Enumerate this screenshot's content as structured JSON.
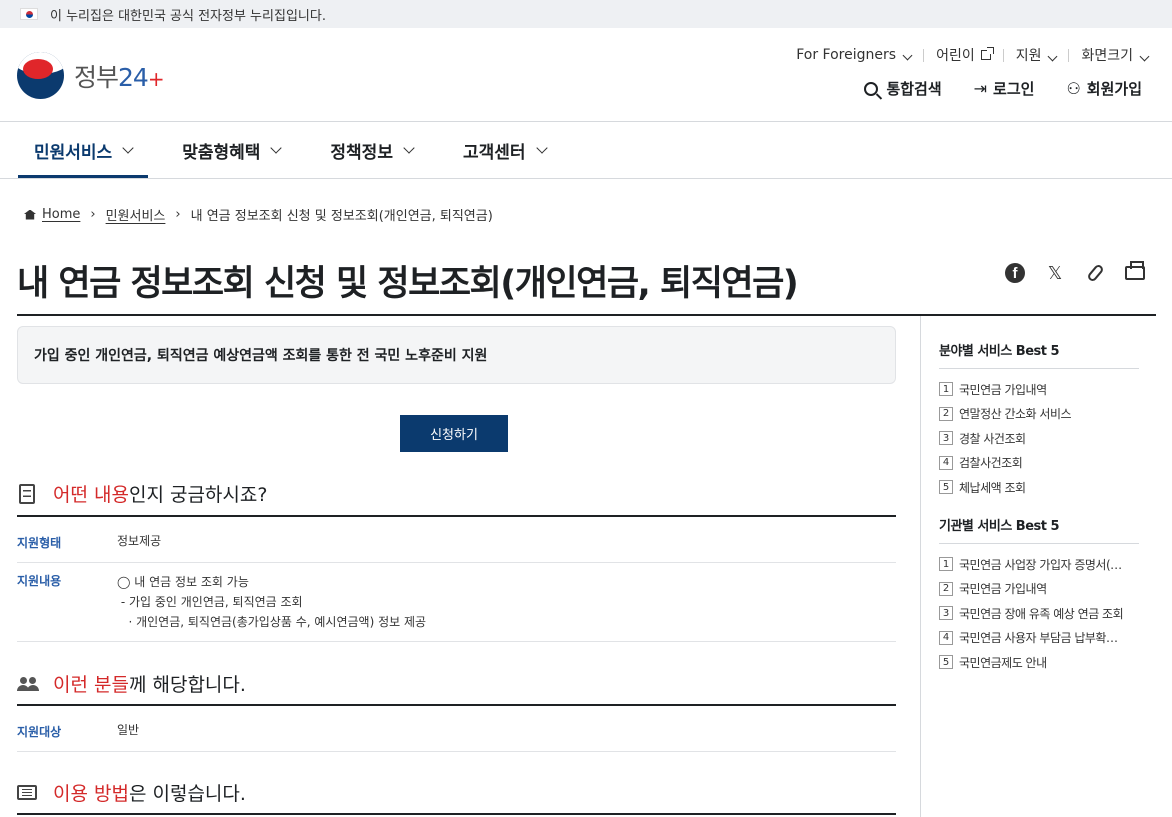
{
  "topbar": {
    "notice": "이 누리집은 대한민국 공식 전자정부 누리집입니다."
  },
  "logo": {
    "text_main": "정부",
    "text_num": "24",
    "plus": "+"
  },
  "util": {
    "foreigners": "For Foreigners",
    "kids": "어린이",
    "support": "지원",
    "zoom": "화면크기"
  },
  "actions": {
    "search": "통합검색",
    "login": "로그인",
    "signup": "회원가입"
  },
  "nav": [
    {
      "label": "민원서비스"
    },
    {
      "label": "맞춤형혜택"
    },
    {
      "label": "정책정보"
    },
    {
      "label": "고객센터"
    }
  ],
  "breadcrumb": {
    "home": "Home",
    "level1": "민원서비스",
    "current": "내 연금 정보조회 신청 및 정보조회(개인연금, 퇴직연금)"
  },
  "page": {
    "title": "내 연금 정보조회 신청 및 정보조회(개인연금, 퇴직연금)",
    "summary": "가입 중인 개인연금, 퇴직연금 예상연금액 조회를 통한 전 국민 노후준비 지원",
    "apply_button": "신청하기"
  },
  "sections": {
    "what": {
      "hl": "어떤 내용",
      "rest": "인지 궁금하시죠?"
    },
    "who": {
      "hl": "이런 분들",
      "rest": "께 해당합니다."
    },
    "how": {
      "hl": "이용 방법",
      "rest": "은 이렇습니다."
    }
  },
  "rows": {
    "type": {
      "key": "지원형태",
      "value": "정보제공"
    },
    "content": {
      "key": "지원내용",
      "line1": "◯ 내 연금 정보 조회 가능",
      "line2": " - 가입 중인 개인연금, 퇴직연금 조회",
      "line3": "   · 개인연금, 퇴직연금(총가입상품 수, 예시연금액) 정보 제공"
    },
    "target": {
      "key": "지원대상",
      "value": "일반"
    }
  },
  "sidebar": {
    "field_best": {
      "title": "분야별 서비스 Best 5",
      "items": [
        "국민연금 가입내역",
        "연말정산 간소화 서비스",
        "경찰 사건조회",
        "검찰사건조회",
        "체납세액 조회"
      ]
    },
    "agency_best": {
      "title": "기관별 서비스 Best 5",
      "items": [
        "국민연금 사업장 가입자 증명서(…",
        "국민연금 가입내역",
        "국민연금 장애 유족 예상 연금 조회",
        "국민연금 사용자 부담금 납부확…",
        "국민연금제도 안내"
      ]
    }
  },
  "colors": {
    "primary": "#0b3a6e",
    "highlight": "#d42a2a",
    "key_blue": "#2a5ea8"
  },
  "icons": [
    "flag-icon",
    "chevron-down-icon",
    "external-link-icon",
    "search-icon",
    "login-icon",
    "user-add-icon",
    "home-icon",
    "facebook-icon",
    "x-icon",
    "clip-icon",
    "print-icon",
    "document-icon",
    "people-icon",
    "screen-icon"
  ]
}
